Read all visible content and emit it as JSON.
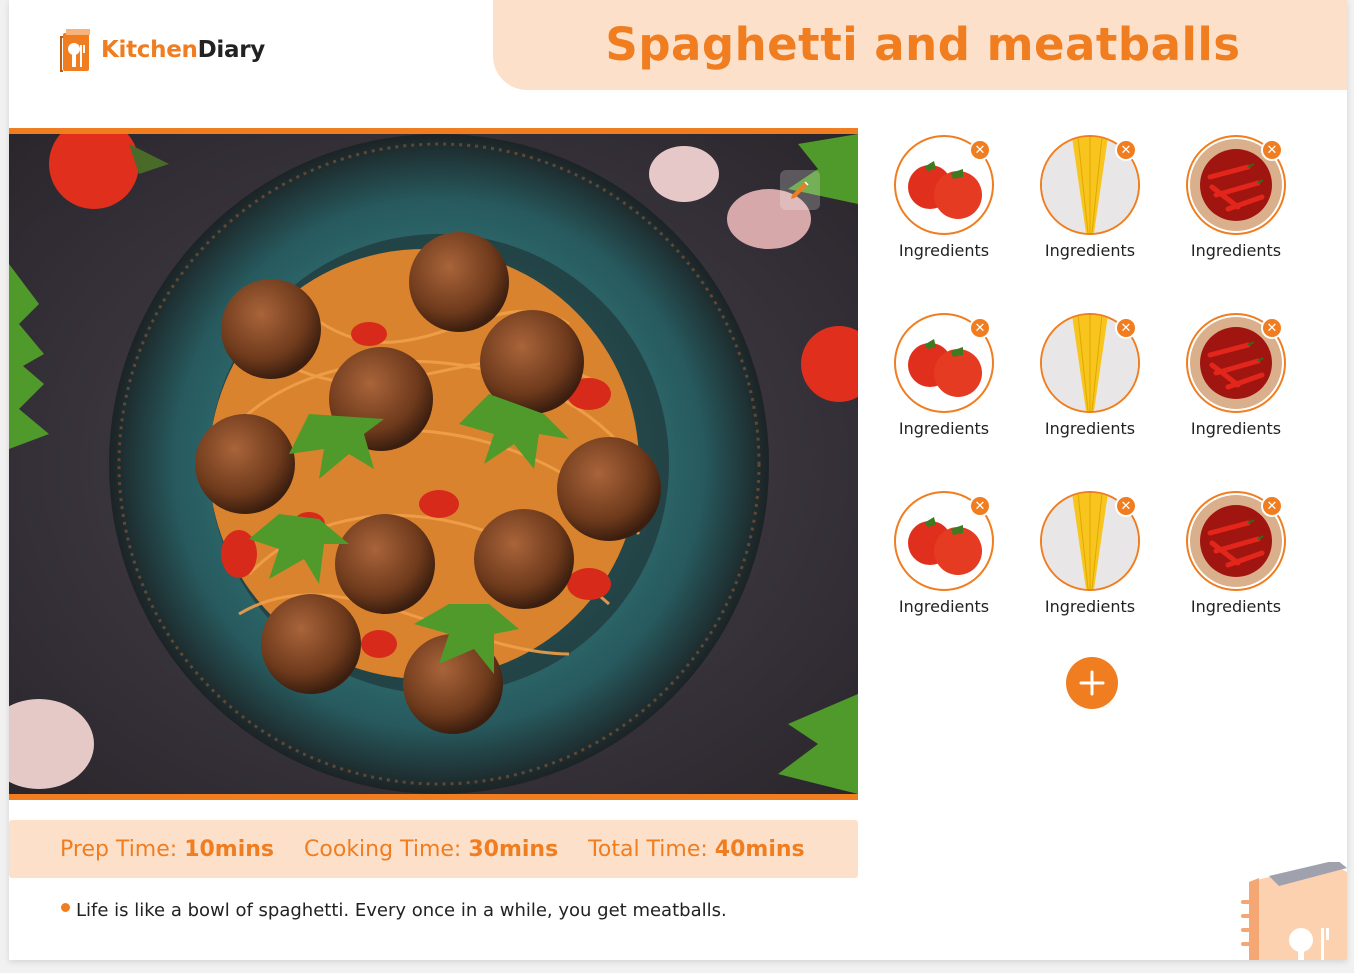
{
  "brand": {
    "name_part1": "Kitchen",
    "name_part2": "Diary"
  },
  "recipe": {
    "title": "Spaghetti and meatballs",
    "prep_label": "Prep Time:",
    "prep_value": "10mins",
    "cook_label": "Cooking Time:",
    "cook_value": "30mins",
    "total_label": "Total Time:",
    "total_value": "40mins",
    "quote": "Life is like a bowl of spaghetti. Every once in a while, you get meatballs."
  },
  "ingredients": [
    {
      "label": "Ingredients",
      "icon": "tomato-icon"
    },
    {
      "label": "Ingredients",
      "icon": "spaghetti-icon"
    },
    {
      "label": "Ingredients",
      "icon": "chili-icon"
    },
    {
      "label": "Ingredients",
      "icon": "tomato-icon"
    },
    {
      "label": "Ingredients",
      "icon": "spaghetti-icon"
    },
    {
      "label": "Ingredients",
      "icon": "chili-icon"
    },
    {
      "label": "Ingredients",
      "icon": "tomato-icon"
    },
    {
      "label": "Ingredients",
      "icon": "spaghetti-icon"
    },
    {
      "label": "Ingredients",
      "icon": "chili-icon"
    }
  ],
  "colors": {
    "accent": "#f07d1f",
    "accent_light": "#fde0ca"
  }
}
